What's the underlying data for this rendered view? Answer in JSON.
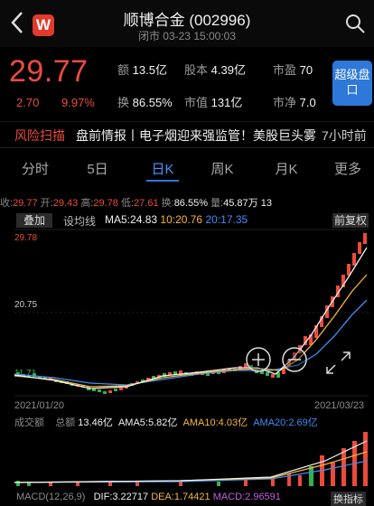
{
  "header": {
    "title": "顺博合金 (002996)",
    "subtitle": "闭市 03-23 15:00:03",
    "logo": "W"
  },
  "quote": {
    "price": "29.77",
    "change": "2.70",
    "change_pct": "9.97%",
    "rows": [
      [
        {
          "label": "额",
          "value": "13.5亿"
        },
        {
          "label": "股本",
          "value": "4.39亿"
        },
        {
          "label": "市盈",
          "value": "70"
        }
      ],
      [
        {
          "label": "换",
          "value": "86.55%"
        },
        {
          "label": "市值",
          "value": "131亿"
        },
        {
          "label": "市净",
          "value": "7.0"
        }
      ]
    ],
    "super_button": "超级盘口"
  },
  "news": {
    "risk_label": "风险扫描",
    "headline": "盘前情报丨电子烟迎来强监管！美股巨头雾",
    "time": "7小时前"
  },
  "tabs": [
    "分时",
    "5日",
    "日K",
    "周K",
    "月K",
    "更多"
  ],
  "stats": {
    "close_label": "收:",
    "close": "29.77",
    "open_label": "开:",
    "open": "29.43",
    "high_label": "高:",
    "high": "29.78",
    "low_label": "低:",
    "low": "27.61",
    "turn_label": "换:",
    "turn": "86.55%",
    "vol_label": "量:",
    "vol": "45.87万",
    "extra": "13"
  },
  "controls": {
    "add": "叠加",
    "set_ma": "设均线",
    "adjust": "前复权"
  },
  "ma": {
    "ma5_label": "MA5:",
    "ma5": "24.83",
    "ma10_label": "10:",
    "ma10": "20.76",
    "ma20_label": "20:",
    "ma20": "17.35"
  },
  "axis": {
    "y_top": "29.78",
    "y_mid": "20.75",
    "y_low": "11.71",
    "date_start": "2021/01/20",
    "date_end": "2021/03/23"
  },
  "volume": {
    "title": "成交额",
    "total_label": "总额",
    "total": "13.46亿",
    "ama5_label": "AMA5:",
    "ama5": "5.82亿",
    "ama10_label": "AMA10:",
    "ama10": "4.03亿",
    "ama20_label": "AMA20:",
    "ama20": "2.69亿"
  },
  "macd": {
    "label": "MACD(12,26,9)",
    "dif": "DIF:3.22717",
    "dea": "DEA:1.74421",
    "macd": "MACD:2.96591",
    "switch": "换指标"
  },
  "colors": {
    "up": "#ec4b3c",
    "down": "#34b24a",
    "ma5": "#f1f1f1",
    "ma10": "#f5b83a",
    "ma20": "#3e8ef7",
    "accent": "#2d78d8"
  }
}
